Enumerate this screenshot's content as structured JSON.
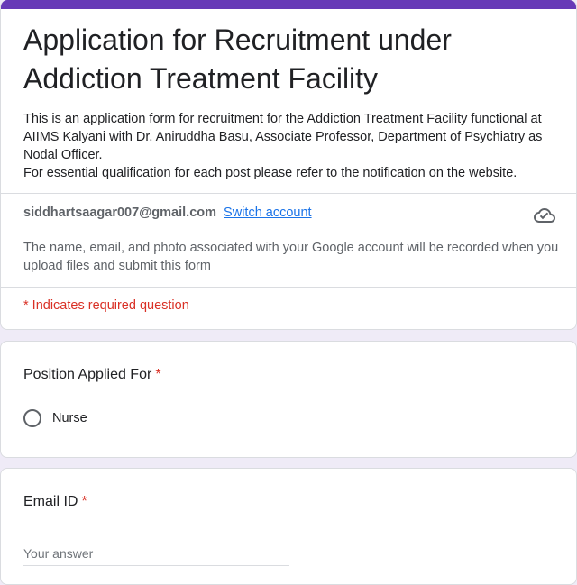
{
  "header": {
    "title": "Application for Recruitment under Addiction Treatment Facility",
    "description_lines": [
      "This is an application form for recruitment for the Addiction Treatment Facility functional at AIIMS Kalyani with Dr. Aniruddha Basu, Associate Professor, Department of Psychiatry as Nodal Officer.",
      "For essential qualification for each post please refer to the notification on the website."
    ],
    "accent_color": "#673ab7"
  },
  "account": {
    "email": "siddhartsaagar007@gmail.com",
    "switch_label": "Switch account",
    "privacy_note": "The name, email, and photo associated with your Google account will be recorded when you upload files and submit this form",
    "cloud_icon": "cloud-check-icon"
  },
  "required_note": "* Indicates required question",
  "questions": [
    {
      "title": "Position Applied For",
      "required_mark": "*",
      "options": [
        "Nurse"
      ]
    },
    {
      "title": "Email ID",
      "required_mark": "*",
      "placeholder": "Your answer"
    }
  ],
  "colors": {
    "background": "#efebf7",
    "required": "#d93025",
    "link": "#1a73e8"
  }
}
